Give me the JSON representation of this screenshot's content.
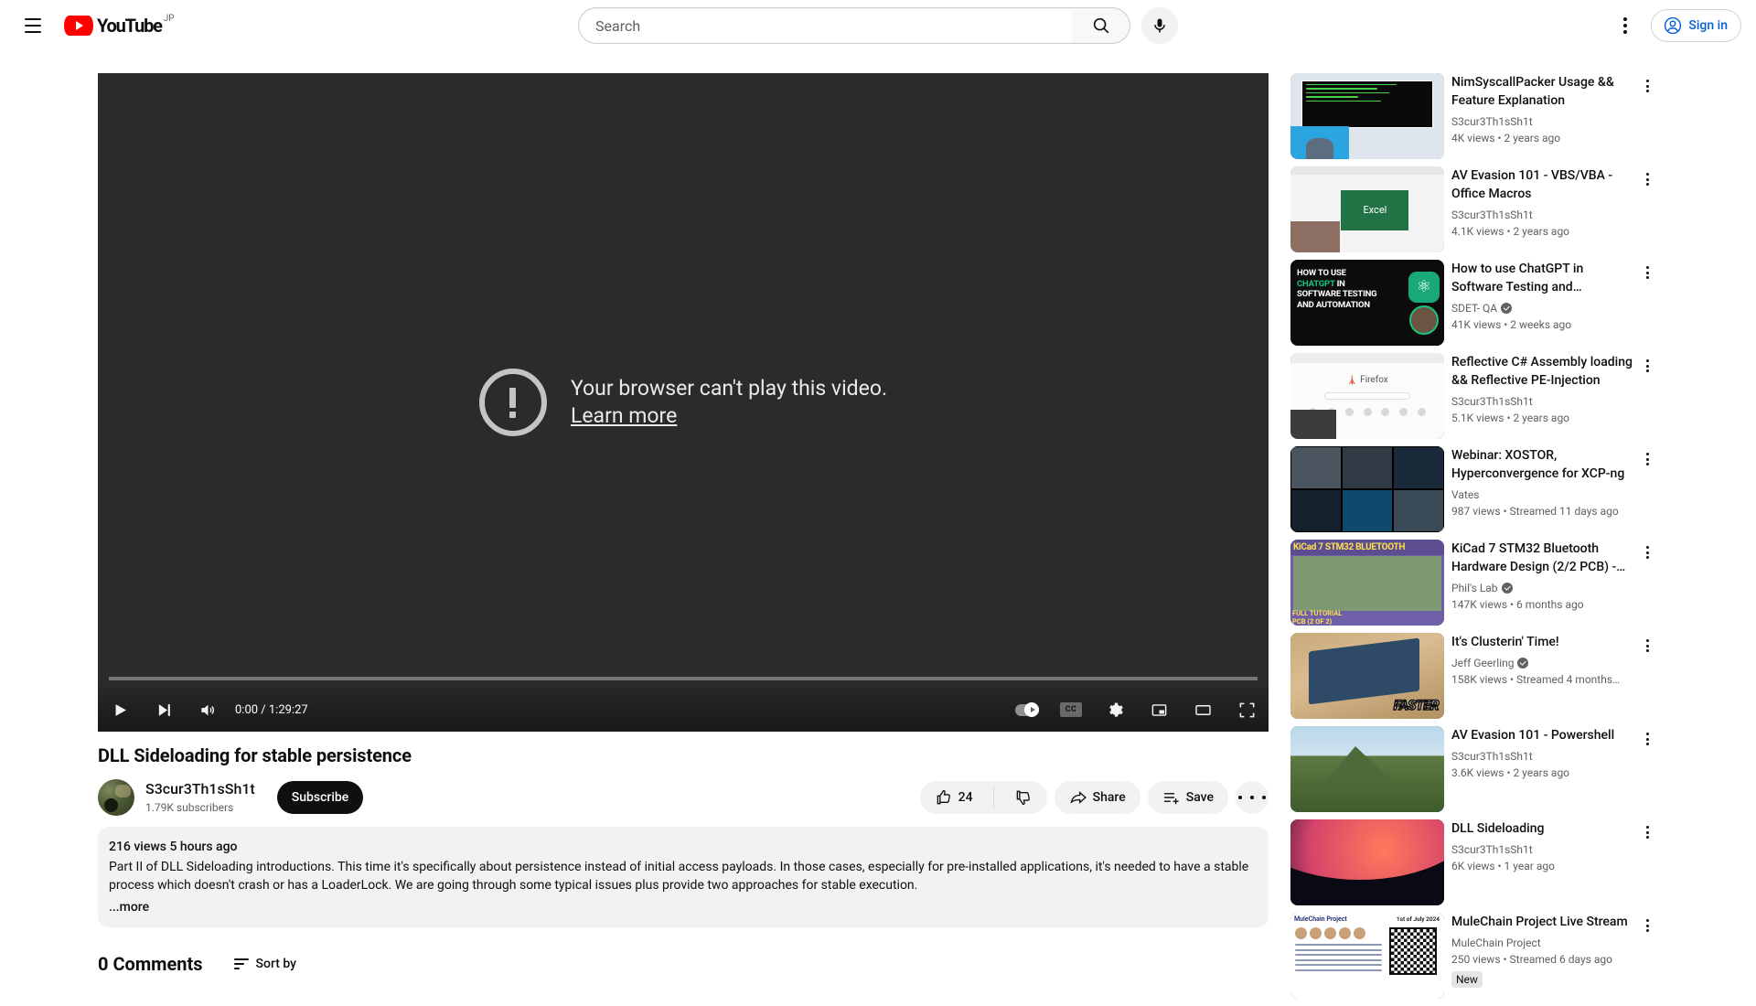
{
  "masthead": {
    "menu_icon": "hamburger-icon",
    "logo_text": "YouTube",
    "logo_country": "JP",
    "search": {
      "placeholder": "Search",
      "value": "",
      "search_icon": "search-icon",
      "mic_icon": "microphone-icon"
    },
    "settings_icon": "kebab-menu-icon",
    "sign_in_label": "Sign in",
    "sign_in_icon": "account-circle-icon",
    "accent_color": "#065fd4"
  },
  "player": {
    "error_title": "Your browser can't play this video.",
    "error_link": "Learn more",
    "error_icon": "alert-circle-icon",
    "controls": {
      "play_icon": "play-icon",
      "next_icon": "next-track-icon",
      "volume_icon": "volume-icon",
      "time_current": "0:00",
      "time_separator": "/",
      "time_duration": "1:29:27",
      "time_display": "0:00 / 1:29:27",
      "autoplay_icon": "autoplay-toggle-icon",
      "captions_label": "CC",
      "settings_icon": "gear-icon",
      "miniplayer_icon": "miniplayer-icon",
      "theater_icon": "theater-mode-icon",
      "fullscreen_icon": "fullscreen-icon"
    },
    "progress_percent": 0,
    "progress_color": "#ff0000"
  },
  "video": {
    "title": "DLL Sideloading for stable persistence",
    "channel_name": "S3cur3Th1sSh1t",
    "subscriber_count": "1.79K subscribers",
    "subscribe_label": "Subscribe",
    "like_count": "24",
    "like_icon": "thumbs-up-icon",
    "dislike_icon": "thumbs-down-icon",
    "share_label": "Share",
    "share_icon": "share-icon",
    "save_label": "Save",
    "save_icon": "save-to-playlist-icon",
    "more_icon": "more-actions-icon",
    "views": "216 views",
    "published": "5 hours ago",
    "stats_line": "216 views  5 hours ago",
    "description": "Part II of DLL Sideloading introductions. This time it's specifically about persistence instead of initial access payloads. In those cases, especially for pre-installed applications, it's needed to have a stable process which doesn't crash or has a LoaderLock. We are going through some typical issues plus provide two approaches for stable execution.",
    "more_label": "...more"
  },
  "comments": {
    "count_label": "0 Comments",
    "sort_label": "Sort by",
    "sort_icon": "sort-icon"
  },
  "recommendations": [
    {
      "title": "NimSyscallPacker Usage && Feature Explanation",
      "channel": "S3cur3Th1sSh1t",
      "verified": false,
      "stats": "4K views  •  2 years ago",
      "badge": "",
      "thumb": "terminal"
    },
    {
      "title": "AV Evasion 101 - VBS/VBA - Office Macros",
      "channel": "S3cur3Th1sSh1t",
      "verified": false,
      "stats": "4.1K views  •  2 years ago",
      "badge": "",
      "thumb": "excel"
    },
    {
      "title": "How to use ChatGPT in Software Testing and…",
      "channel": "SDET- QA",
      "verified": true,
      "stats": "41K views  •  2 weeks ago",
      "badge": "",
      "thumb": "chatgpt"
    },
    {
      "title": "Reflective C# Assembly loading && Reflective PE-Injection",
      "channel": "S3cur3Th1sSh1t",
      "verified": false,
      "stats": "5.1K views  •  2 years ago",
      "badge": "",
      "thumb": "firefox"
    },
    {
      "title": "Webinar: XOSTOR, Hyperconvergence for XCP-ng",
      "channel": "Vates",
      "verified": false,
      "stats": "987 views  •  Streamed 11 days ago",
      "badge": "",
      "thumb": "webinar"
    },
    {
      "title": "KiCad 7 STM32 Bluetooth Hardware Design (2/2 PCB) -…",
      "channel": "Phil's Lab",
      "verified": true,
      "stats": "147K views  •  6 months ago",
      "badge": "",
      "thumb": "kicad",
      "thumb_text_top": "KiCad 7 STM32 BLUETOOTH",
      "thumb_text_bottom": "FULL TUTORIAL PCB (2 OF 2)"
    },
    {
      "title": "It's Clusterin' Time!",
      "channel": "Jeff Geerling",
      "verified": true,
      "stats": "158K views  •  Streamed 4 months…",
      "badge": "",
      "thumb": "cluster",
      "thumb_text_bottom": "FASTER"
    },
    {
      "title": "AV Evasion 101 - Powershell",
      "channel": "S3cur3Th1sSh1t",
      "verified": false,
      "stats": "3.6K views  •  2 years ago",
      "badge": "",
      "thumb": "mountain"
    },
    {
      "title": "DLL Sideloading",
      "channel": "S3cur3Th1sSh1t",
      "verified": false,
      "stats": "6K views  •  1 year ago",
      "badge": "",
      "thumb": "space"
    },
    {
      "title": "MuleChain Project Live Stream",
      "channel": "MuleChain Project",
      "verified": false,
      "stats": "250 views  •  Streamed 6 days ago",
      "badge": "New",
      "thumb": "mule",
      "thumb_text_top": "MuleChain Project",
      "thumb_text_date": "1st of July 2024"
    }
  ]
}
